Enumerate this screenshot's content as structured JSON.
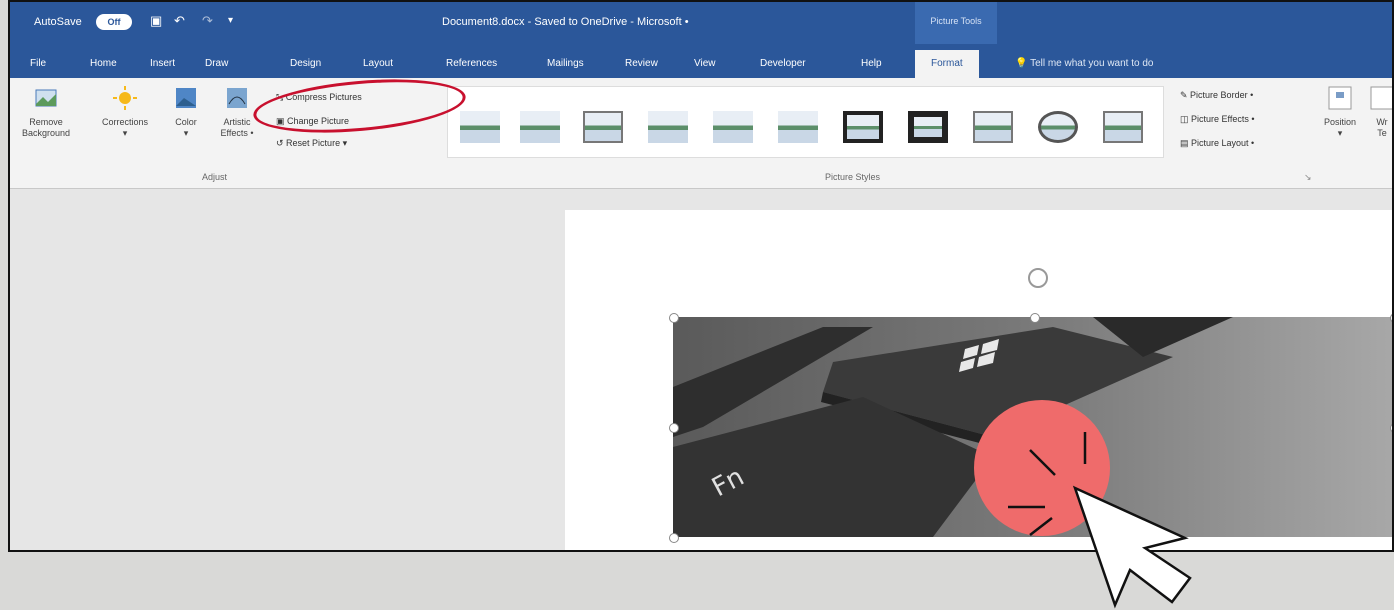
{
  "titlebar": {
    "autosave_label": "AutoSave",
    "autosave_state": "Off",
    "doc_title": "Document8.docx  -  Saved to OneDrive  -  Microsoft  •",
    "context_label": "Picture Tools"
  },
  "tabs": [
    "File",
    "Home",
    "Insert",
    "Draw",
    "Design",
    "Layout",
    "References",
    "Mailings",
    "Review",
    "View",
    "Developer",
    "Help"
  ],
  "active_tab": "Format",
  "tellme": "Tell me what you want to do",
  "ribbon": {
    "adjust": {
      "remove_bg": "Remove\nBackground",
      "corrections": "Corrections",
      "color": "Color",
      "artistic": "Artistic\nEffects •",
      "compress": "Compress Pictures",
      "change": "Change Picture",
      "reset": "Reset Picture",
      "group_label": "Adjust"
    },
    "styles": {
      "border": "Picture Border •",
      "effects": "Picture Effects •",
      "layout": "Picture Layout •",
      "group_label": "Picture Styles"
    },
    "arrange": {
      "position": "Position",
      "wrap": "Wr\nTe"
    }
  },
  "photo": {
    "key_text": "Fn"
  },
  "colors": {
    "ribbon_blue": "#2b579a",
    "highlight_red": "#c8102e",
    "click_circle": "#ef6b6b"
  }
}
